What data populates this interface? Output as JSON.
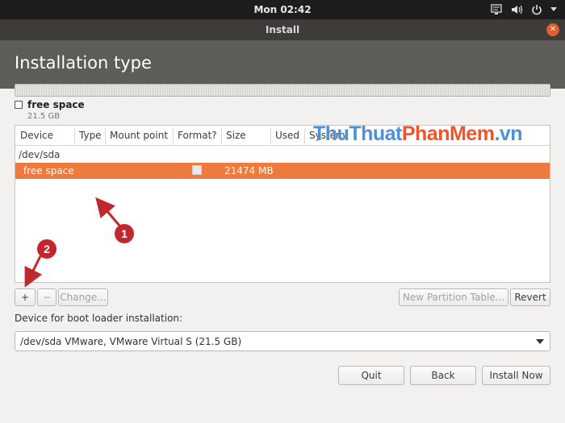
{
  "topbar": {
    "clock": "Mon 02:42",
    "icons": [
      "network-icon",
      "volume-icon",
      "power-icon"
    ]
  },
  "window": {
    "title": "Install",
    "page_title": "Installation type"
  },
  "disk": {
    "legend_name": "free space",
    "legend_size": "21.5 GB"
  },
  "table": {
    "columns": [
      "Device",
      "Type",
      "Mount point",
      "Format?",
      "Size",
      "Used",
      "System"
    ],
    "device": "/dev/sda",
    "rows": [
      {
        "device": "free space",
        "size": "21474 MB",
        "format_checked": false,
        "selected": true
      }
    ]
  },
  "toolbar": {
    "add_label": "+",
    "remove_label": "−",
    "change_label": "Change...",
    "new_table_label": "New Partition Table...",
    "revert_label": "Revert"
  },
  "bootloader": {
    "label": "Device for boot loader installation:",
    "value": "/dev/sda VMware, VMware Virtual S (21.5 GB)"
  },
  "footer": {
    "quit_label": "Quit",
    "back_label": "Back",
    "install_label": "Install Now"
  },
  "watermark": {
    "part1": "ThuThuat",
    "part2": "PhanMem",
    "part3": ".vn"
  },
  "annotations": {
    "badge1": "1",
    "badge2": "2"
  },
  "colors": {
    "selection": "#ee7a3e",
    "header": "#5e5c58",
    "badge": "#c1272d"
  }
}
